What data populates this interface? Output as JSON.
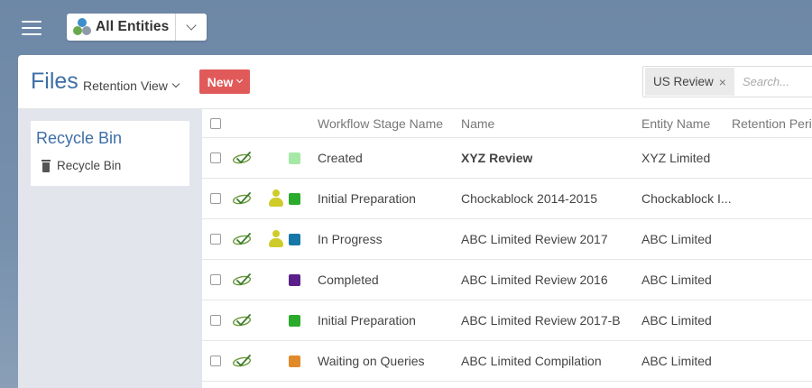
{
  "topbar": {
    "entity_selector": "All Entities"
  },
  "header": {
    "title": "Files",
    "view": "Retention View",
    "new_button": "New",
    "filter_tag": "US Review",
    "search_placeholder": "Search..."
  },
  "sidebar": {
    "title": "Recycle Bin",
    "item": "Recycle Bin"
  },
  "table": {
    "columns": {
      "stage": "Workflow Stage Name",
      "name": "Name",
      "entity": "Entity Name",
      "retention": "Retention Peri"
    },
    "rows": [
      {
        "stage": "Created",
        "name": "XYZ Review",
        "entity": "XYZ Limited",
        "color": "#a6e8a6",
        "user": false
      },
      {
        "stage": "Initial Preparation",
        "name": "Chockablock 2014-2015",
        "entity": "Chockablock I...",
        "color": "#2bab2b",
        "user": true
      },
      {
        "stage": "In Progress",
        "name": "ABC Limited Review 2017",
        "entity": "ABC Limited",
        "color": "#1678a8",
        "user": true
      },
      {
        "stage": "Completed",
        "name": "ABC Limited Review 2016",
        "entity": "ABC Limited",
        "color": "#5a1f8a",
        "user": false
      },
      {
        "stage": "Initial Preparation",
        "name": "ABC Limited Review 2017-B",
        "entity": "ABC Limited",
        "color": "#2bab2b",
        "user": false
      },
      {
        "stage": "Waiting on Queries",
        "name": "ABC Limited Compilation",
        "entity": "ABC Limited",
        "color": "#e08a2a",
        "user": false
      }
    ]
  },
  "colors": {
    "accent": "#3e6fa7",
    "new_button": "#e15a5a",
    "background": "#6d87a6"
  }
}
